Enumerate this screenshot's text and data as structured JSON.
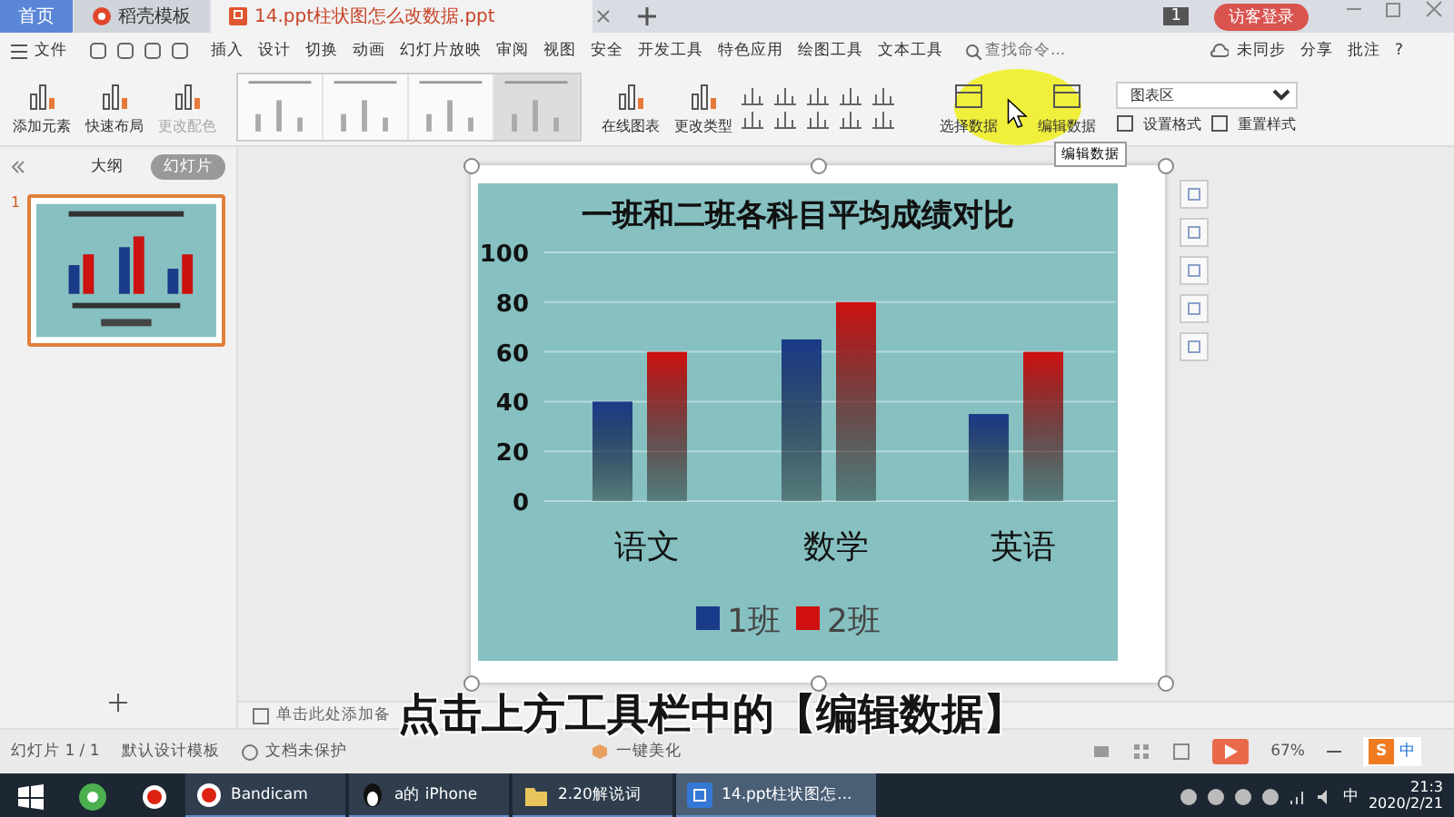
{
  "tabs": [
    {
      "label": "首页",
      "kind": "home",
      "selected": false
    },
    {
      "label": "稻壳模板",
      "kind": "app",
      "selected": false
    },
    {
      "label": "14.ppt柱状图怎么改数据.ppt",
      "kind": "doc",
      "selected": true
    }
  ],
  "title_bar": {
    "badge": "1",
    "login": "访客登录"
  },
  "menu": {
    "file": "文件",
    "items": [
      "插入",
      "设计",
      "切换",
      "动画",
      "幻灯片放映",
      "审阅",
      "视图",
      "安全",
      "开发工具",
      "特色应用",
      "绘图工具",
      "文本工具"
    ],
    "search": {
      "placeholder": "查找命令..."
    },
    "sync": "未同步",
    "share": "分享",
    "comment": "批注",
    "help": "?"
  },
  "ribbon": {
    "buttons": [
      {
        "label": "添加元素",
        "disabled": false
      },
      {
        "label": "快速布局",
        "disabled": false
      },
      {
        "label": "更改配色",
        "disabled": true
      }
    ],
    "styles": [
      {
        "selected": false
      },
      {
        "selected": false
      },
      {
        "selected": false
      },
      {
        "selected": true
      }
    ],
    "chart_buttons": [
      {
        "label": "在线图表"
      },
      {
        "label": "更改类型"
      }
    ],
    "data_buttons": [
      {
        "label": "选择数据"
      },
      {
        "label": "编辑数据"
      }
    ],
    "element_select": {
      "value": "图表区"
    },
    "format": "设置格式",
    "reset": "重置样式",
    "tooltip": "编辑数据"
  },
  "sidebar": {
    "tabs": [
      {
        "label": "大纲",
        "selected": false
      },
      {
        "label": "幻灯片",
        "selected": true
      }
    ],
    "slides": [
      {
        "number": "1",
        "selected": true
      }
    ]
  },
  "slide": {
    "chart_data": {
      "type": "bar",
      "title": "一班和二班各科目平均成绩对比",
      "categories": [
        "语文",
        "数学",
        "英语"
      ],
      "series": [
        {
          "name": "1班",
          "color": "#1a3a8a",
          "values": [
            40,
            65,
            35
          ]
        },
        {
          "name": "2班",
          "color": "#d01010",
          "values": [
            60,
            80,
            60
          ]
        }
      ],
      "ylim": [
        0,
        100
      ],
      "yticks": [
        0,
        20,
        40,
        60,
        80,
        100
      ],
      "grid": true,
      "legend": true
    }
  },
  "notes": {
    "placeholder": "单击此处添加备"
  },
  "subtitle": "点击上方工具栏中的【编辑数据】",
  "status_bar": {
    "slide": "幻灯片 1 / 1",
    "template": "默认设计模板",
    "protection": "文档未保护",
    "beautify": "一键美化",
    "zoom": "67%",
    "ime_logo": "S",
    "ime": "中"
  },
  "taskbar": {
    "items": [
      {
        "label": "Bandicam",
        "selected": false
      },
      {
        "label": "a的 iPhone",
        "selected": false
      },
      {
        "label": "2.20解说词",
        "selected": false
      },
      {
        "label": "14.ppt柱状图怎...",
        "selected": true
      }
    ],
    "ime": "中",
    "time": "21:3",
    "date": "2020/2/21"
  }
}
